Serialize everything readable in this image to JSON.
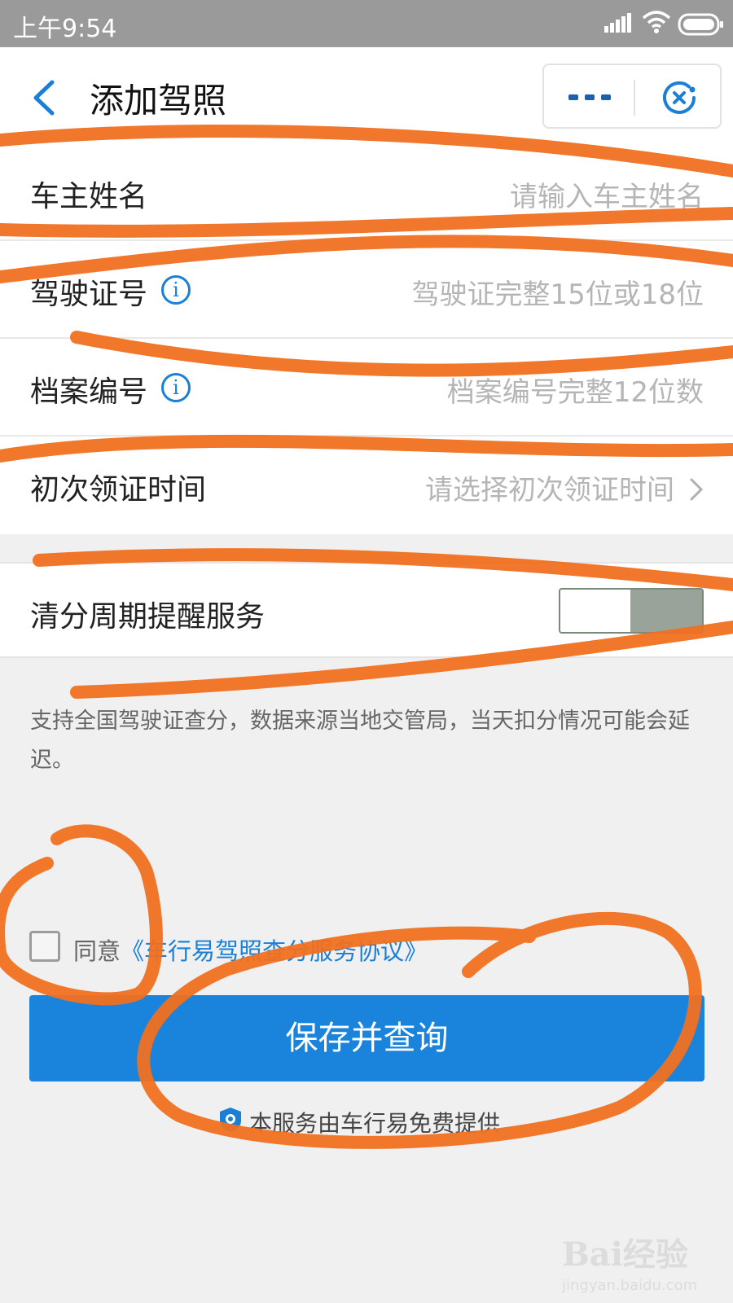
{
  "status_bar": {
    "time": "上午9:54"
  },
  "nav": {
    "title": "添加驾照"
  },
  "form": {
    "rows": [
      {
        "label": "车主姓名",
        "placeholder": "请输入车主姓名"
      },
      {
        "label": "驾驶证号",
        "placeholder": "驾驶证完整15位或18位"
      },
      {
        "label": "档案编号",
        "placeholder": "档案编号完整12位数"
      },
      {
        "label": "初次领证时间",
        "placeholder": "请选择初次领证时间"
      }
    ],
    "reminder": {
      "label": "清分周期提醒服务",
      "toggle_on": false
    }
  },
  "note": "支持全国驾驶证查分，数据来源当地交管局，当天扣分情况可能会延迟。",
  "agreement": {
    "prefix": "同意",
    "link": "《车行易驾照查分服务协议》",
    "checked": false
  },
  "submit_label": "保存并查询",
  "provider_text": "本服务由车行易免费提供",
  "watermark": {
    "brand": "Bai经验",
    "site": "jingyan.baidu.com"
  },
  "colors": {
    "accent": "#1a84dd",
    "annotation": "#f07020"
  }
}
